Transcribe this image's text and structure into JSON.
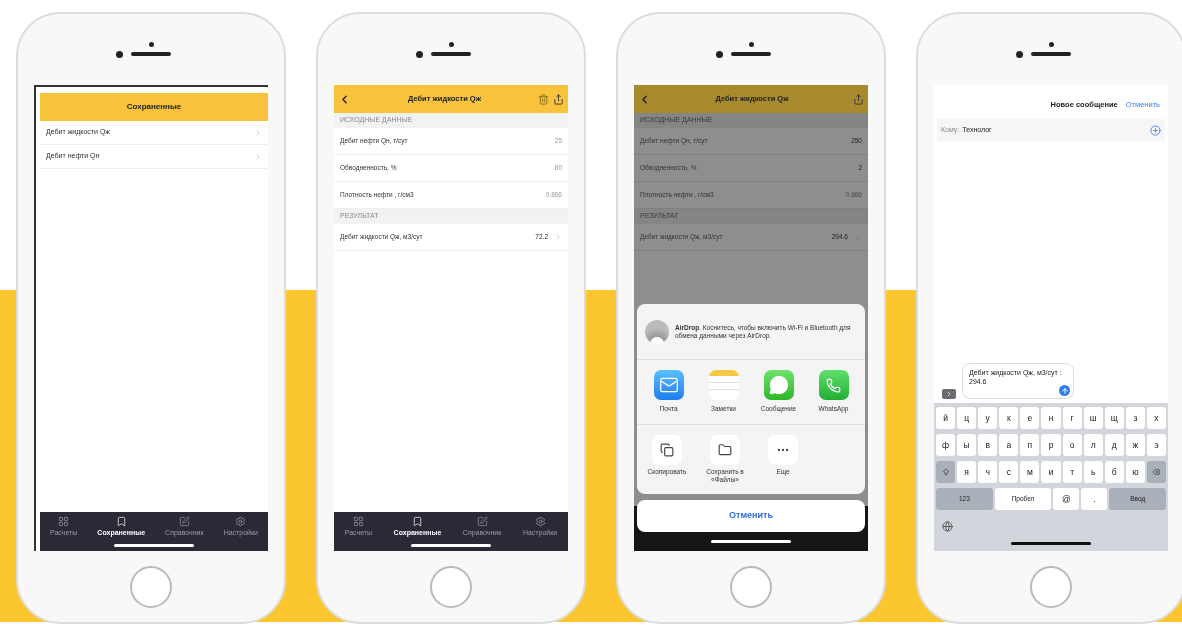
{
  "phones": [
    {
      "kind": "saved_list",
      "header": {
        "title": "Сохраненные"
      },
      "items": [
        {
          "label": "Дебит жидкости Qж"
        },
        {
          "label": "Дебит нефти Qн"
        }
      ],
      "tab_bar": [
        {
          "label": "Расчеты",
          "selected": false
        },
        {
          "label": "Сохраненные",
          "selected": true
        },
        {
          "label": "Справочник",
          "selected": false
        },
        {
          "label": "Настройки",
          "selected": false
        }
      ]
    },
    {
      "kind": "detail",
      "dimmed": false,
      "nav": {
        "title": "Дебит жидкости Qж",
        "delete_button": true
      },
      "sections": [
        {
          "heading": "ИСХОДНЫЕ ДАННЫЕ",
          "rows": [
            {
              "label": "Дебит нефти Qн, т/сут",
              "placeholder": "25",
              "link": false
            },
            {
              "label": "Обводненность, %",
              "placeholder": "80",
              "link": false
            },
            {
              "label": "Плотность нефти , г/см3",
              "placeholder": "0.866",
              "link": false
            }
          ]
        },
        {
          "heading": "РЕЗУЛЬТАТ",
          "rows": [
            {
              "label": "Дебит жидкости Qж, м3/сут",
              "value": "72.2",
              "link": true
            }
          ]
        }
      ],
      "tab_bar": [
        {
          "label": "Расчеты",
          "selected": false
        },
        {
          "label": "Сохраненные",
          "selected": true
        },
        {
          "label": "Справочник",
          "selected": false
        },
        {
          "label": "Настройки",
          "selected": false
        }
      ]
    },
    {
      "kind": "detail",
      "dimmed": true,
      "nav": {
        "title": "Дебит жидкости Qж",
        "delete_button": false
      },
      "sections": [
        {
          "heading": "ИСХОДНЫЕ ДАННЫЕ",
          "rows": [
            {
              "label": "Дебит нефти Qн, т/сут",
              "value": "250",
              "link": false
            },
            {
              "label": "Обводненность, %",
              "value": "2",
              "link": false
            },
            {
              "label": "Плотность нефти , г/см3",
              "placeholder": "0.866",
              "link": false
            }
          ]
        },
        {
          "heading": "РЕЗУЛЬТАТ",
          "rows": [
            {
              "label": "Дебит жидкости Qж, м3/сут",
              "value": "294.6",
              "link": true
            }
          ]
        }
      ],
      "share_sheet": {
        "airdrop": "**AirDrop**. Коснитесь, чтобы включить Wi-Fi и Bluetooth для обмена данными через AirDrop.",
        "apps": [
          {
            "label": "Почта"
          },
          {
            "label": "Заметки"
          },
          {
            "label": "Сообщение"
          },
          {
            "label": "WhatsApp"
          }
        ],
        "actions": [
          {
            "label": "Скопировать"
          },
          {
            "label": "Сохранить в «Файлы»"
          },
          {
            "label": "Еще"
          }
        ],
        "cancel": "Отменить"
      }
    },
    {
      "kind": "compose",
      "title": "Новое сообщение",
      "cancel": "Отменить",
      "to_label": "Кому:",
      "to_value": "Технолог",
      "message": "Дебит жидкости Qж, м3/сут : 294.6",
      "keyboard": [
        {
          "keys": [
            {
              "kind": "letter",
              "label": "й"
            },
            {
              "kind": "letter",
              "label": "ц"
            },
            {
              "kind": "letter",
              "label": "у"
            },
            {
              "kind": "letter",
              "label": "к"
            },
            {
              "kind": "letter",
              "label": "е"
            },
            {
              "kind": "letter",
              "label": "н"
            },
            {
              "kind": "letter",
              "label": "г"
            },
            {
              "kind": "letter",
              "label": "ш"
            },
            {
              "kind": "letter",
              "label": "щ"
            },
            {
              "kind": "letter",
              "label": "з"
            },
            {
              "kind": "letter",
              "label": "х"
            }
          ]
        },
        {
          "keys": [
            {
              "kind": "letter",
              "label": "ф"
            },
            {
              "kind": "letter",
              "label": "ы"
            },
            {
              "kind": "letter",
              "label": "в"
            },
            {
              "kind": "letter",
              "label": "а"
            },
            {
              "kind": "letter",
              "label": "п"
            },
            {
              "kind": "letter",
              "label": "р"
            },
            {
              "kind": "letter",
              "label": "о"
            },
            {
              "kind": "letter",
              "label": "л"
            },
            {
              "kind": "letter",
              "label": "д"
            },
            {
              "kind": "letter",
              "label": "ж"
            },
            {
              "kind": "letter",
              "label": "э"
            }
          ]
        },
        {
          "keys": [
            {
              "kind": "shift"
            },
            {
              "kind": "letter",
              "label": "я"
            },
            {
              "kind": "letter",
              "label": "ч"
            },
            {
              "kind": "letter",
              "label": "с"
            },
            {
              "kind": "letter",
              "label": "м"
            },
            {
              "kind": "letter",
              "label": "и"
            },
            {
              "kind": "letter",
              "label": "т"
            },
            {
              "kind": "letter",
              "label": "ь"
            },
            {
              "kind": "letter",
              "label": "б"
            },
            {
              "kind": "letter",
              "label": "ю"
            },
            {
              "kind": "delete"
            }
          ]
        },
        {
          "keys": [
            {
              "kind": "function",
              "label": "123"
            },
            {
              "kind": "space",
              "label": "Пробел"
            },
            {
              "kind": "letter",
              "label": "@"
            },
            {
              "kind": "letter",
              "label": "."
            },
            {
              "kind": "function",
              "label": "Ввод"
            }
          ]
        }
      ]
    }
  ]
}
